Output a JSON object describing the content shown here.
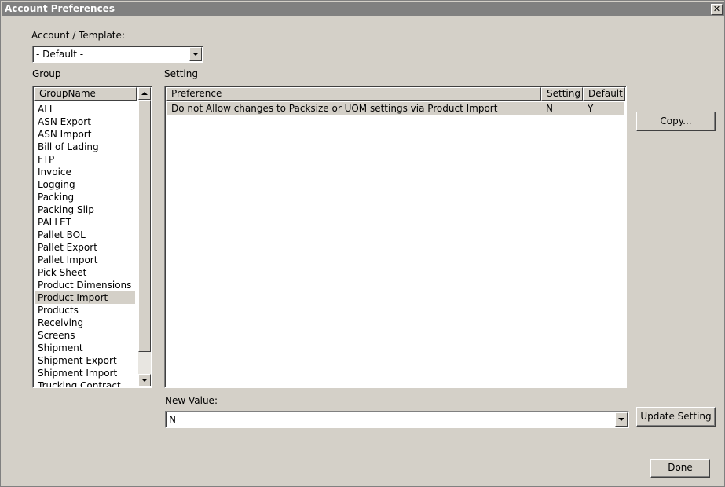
{
  "window": {
    "title": "Account Preferences",
    "close_label": "✕"
  },
  "account_template": {
    "label": "Account / Template:",
    "value": "- Default -"
  },
  "group": {
    "label": "Group",
    "column_header": "GroupName",
    "items": [
      "ALL",
      "ASN Export",
      "ASN Import",
      "Bill of Lading",
      "FTP",
      "Invoice",
      "Logging",
      "Packing",
      "Packing Slip",
      "PALLET",
      "Pallet BOL",
      "Pallet Export",
      "Pallet Import",
      "Pick Sheet",
      "Product Dimensions",
      "Product Import",
      "Products",
      "Receiving",
      "Screens",
      "Shipment",
      "Shipment Export",
      "Shipment Import",
      "Trucking Contract"
    ],
    "selected": "Product Import"
  },
  "setting": {
    "label": "Setting",
    "columns": {
      "preference": "Preference",
      "setting": "Setting",
      "default": "Default"
    },
    "rows": [
      {
        "preference": "Do not Allow changes to Packsize or UOM settings via Product Import",
        "setting": "N",
        "default": "Y"
      }
    ]
  },
  "new_value": {
    "label": "New Value:",
    "value": "N"
  },
  "buttons": {
    "copy": "Copy...",
    "update": "Update Setting",
    "done": "Done"
  },
  "icons": {
    "close": "close-icon",
    "dropdown": "chevron-down-icon",
    "scroll_up": "scroll-up-arrow-icon",
    "scroll_down": "scroll-down-arrow-icon"
  },
  "colors": {
    "face": "#d4d0c8",
    "titlebar": "#808080",
    "field": "#ffffff"
  }
}
